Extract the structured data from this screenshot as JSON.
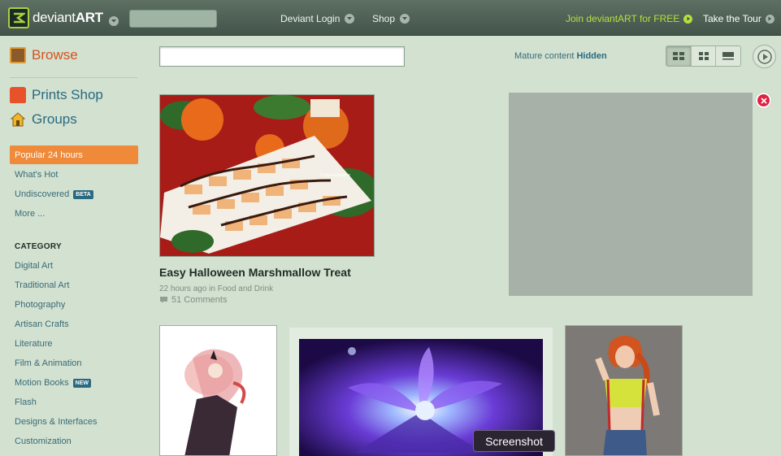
{
  "header": {
    "logo_text_a": "deviant",
    "logo_text_b": "ART",
    "login_label": "Deviant Login",
    "shop_label": "Shop",
    "join_label": "Join deviantART for FREE",
    "tour_label": "Take the Tour"
  },
  "sidebar": {
    "browse": "Browse",
    "prints_shop": "Prints Shop",
    "groups": "Groups",
    "popular": "Popular 24 hours",
    "whats_hot": "What's Hot",
    "undiscovered": "Undiscovered",
    "undiscovered_badge": "BETA",
    "more": "More ...",
    "category_heading": "CATEGORY",
    "categories": [
      {
        "label": "Digital Art"
      },
      {
        "label": "Traditional Art"
      },
      {
        "label": "Photography"
      },
      {
        "label": "Artisan Crafts"
      },
      {
        "label": "Literature"
      },
      {
        "label": "Film & Animation"
      },
      {
        "label": "Motion Books",
        "badge": "NEW"
      },
      {
        "label": "Flash"
      },
      {
        "label": "Designs & Interfaces"
      },
      {
        "label": "Customization"
      }
    ]
  },
  "toolbar": {
    "mature_prefix": "Mature content",
    "mature_value": "Hidden"
  },
  "featured": {
    "watermark": "© theresahelmer",
    "title": "Easy Halloween Marshmallow Treat",
    "meta": "22 hours ago in Food and Drink",
    "comments": "51 Comments"
  },
  "tooltip": {
    "label": "Screenshot"
  },
  "colors": {
    "accent_orange": "#ef8a3a",
    "link_teal": "#386b78",
    "join_green": "#b5e03c",
    "close_red": "#e0213f"
  }
}
